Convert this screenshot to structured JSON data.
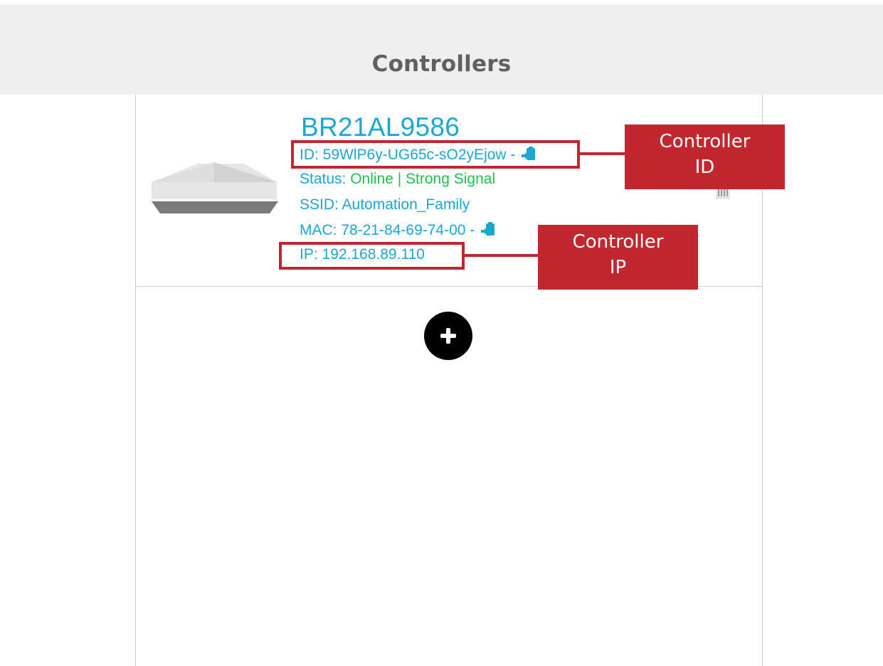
{
  "header": {
    "title": "Controllers"
  },
  "controller": {
    "name": "BR21AL9586",
    "id_line": "ID: 59WlP6y-UG65c-sO2yEjow -",
    "status_label": "Status: ",
    "status_value": "Online | Strong Signal",
    "ssid_line": "SSID: Automation_Family",
    "mac_line": "MAC: 78-21-84-69-74-00 -",
    "ip_line": "IP: 192.168.89.110"
  },
  "callouts": {
    "controller_id": [
      "Controller",
      "ID"
    ],
    "controller_ip": [
      "Controller",
      "IP"
    ]
  },
  "icons": {
    "copy": "clipboard-copy-icon",
    "delete": "trash-icon",
    "add": "plus-circle-icon"
  },
  "colors": {
    "accent": "#1aa7d3",
    "online": "#1fc24a",
    "callout": "#c1272d",
    "header_bg": "#efefef"
  }
}
